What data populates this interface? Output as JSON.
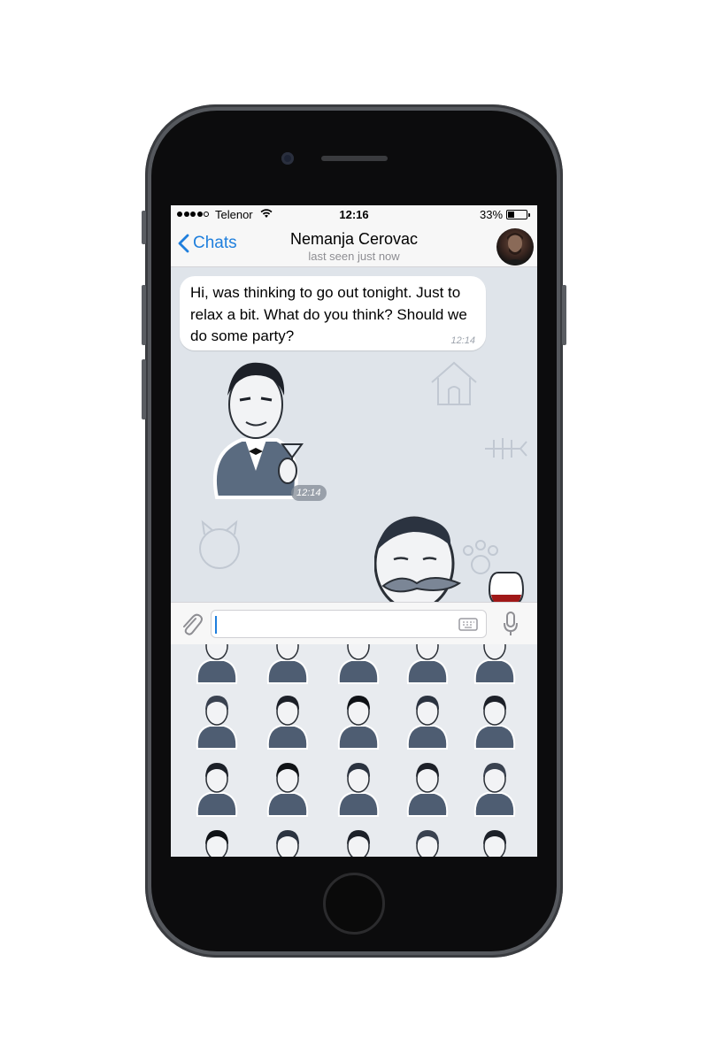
{
  "status_bar": {
    "carrier": "Telenor",
    "time": "12:16",
    "battery_percent": "33%",
    "battery_level": 0.33
  },
  "nav": {
    "back_label": "Chats",
    "title": "Nemanja Cerovac",
    "subtitle": "last seen just now"
  },
  "messages": [
    {
      "type": "text",
      "text": "Hi, was thinking to go out tonight. Just to relax a bit. What do you think? Should we do some party?",
      "time": "12:14"
    },
    {
      "type": "sticker",
      "sticker": "gentleman-with-martini-sticker",
      "time": "12:14"
    },
    {
      "type": "sticker",
      "sticker": "mustached-gentleman-with-wine-sticker"
    }
  ],
  "input": {
    "value": "",
    "placeholder": ""
  },
  "colors": {
    "accent": "#1f7fdd",
    "chat_background": "#dfe4ea",
    "sticker_panel": "#e8ebef"
  }
}
